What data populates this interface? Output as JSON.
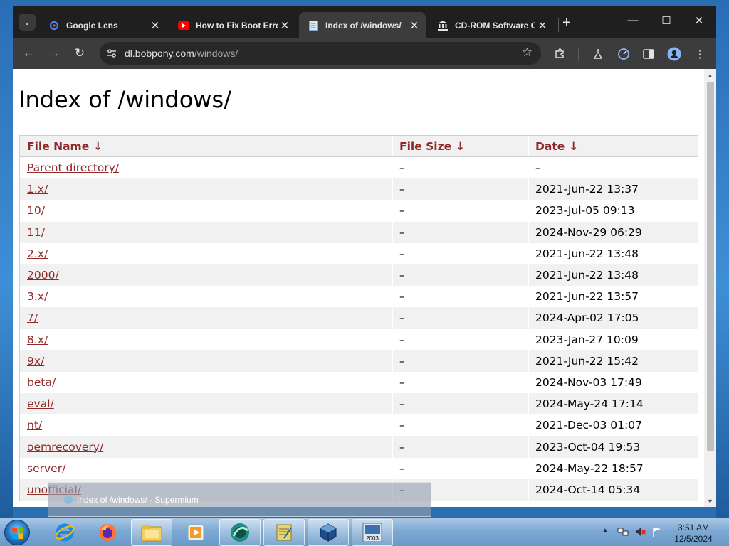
{
  "browser": {
    "name": "Supermium",
    "tabs": [
      {
        "title": "Google Lens",
        "favicon": "google-lens-icon"
      },
      {
        "title": "How to Fix Boot Error",
        "favicon": "youtube-icon"
      },
      {
        "title": "Index of /windows/",
        "favicon": "document-icon",
        "active": true
      },
      {
        "title": "CD-ROM Software Collection",
        "favicon": "bank-icon"
      }
    ],
    "address": {
      "domain": "dl.bobpony.com",
      "path": "/windows/"
    }
  },
  "page": {
    "title": "Index of /windows/",
    "headers": {
      "name": "File Name",
      "size": "File Size",
      "date": "Date",
      "sort_arrow": "↓"
    },
    "rows": [
      {
        "name": "Parent directory/",
        "size": "–",
        "date": "–"
      },
      {
        "name": "1.x/",
        "size": "–",
        "date": "2021-Jun-22 13:37"
      },
      {
        "name": "10/",
        "size": "–",
        "date": "2023-Jul-05 09:13"
      },
      {
        "name": "11/",
        "size": "–",
        "date": "2024-Nov-29 06:29"
      },
      {
        "name": "2.x/",
        "size": "–",
        "date": "2021-Jun-22 13:48"
      },
      {
        "name": "2000/",
        "size": "–",
        "date": "2021-Jun-22 13:48"
      },
      {
        "name": "3.x/",
        "size": "–",
        "date": "2021-Jun-22 13:57"
      },
      {
        "name": "7/",
        "size": "–",
        "date": "2024-Apr-02 17:05"
      },
      {
        "name": "8.x/",
        "size": "–",
        "date": "2023-Jan-27 10:09"
      },
      {
        "name": "9x/",
        "size": "–",
        "date": "2021-Jun-22 15:42"
      },
      {
        "name": "beta/",
        "size": "–",
        "date": "2024-Nov-03 17:49"
      },
      {
        "name": "eval/",
        "size": "–",
        "date": "2024-May-24 17:14"
      },
      {
        "name": "nt/",
        "size": "–",
        "date": "2021-Dec-03 01:07"
      },
      {
        "name": "oemrecovery/",
        "size": "–",
        "date": "2023-Oct-04 19:53"
      },
      {
        "name": "server/",
        "size": "–",
        "date": "2024-May-22 18:57"
      },
      {
        "name": "unofficial/",
        "size": "–",
        "date": "2024-Oct-14 05:34"
      }
    ]
  },
  "taskbar": {
    "preview_title": "Index of /windows/ - Supermium",
    "apps": [
      "internet-explorer-icon",
      "firefox-icon",
      "file-explorer-icon",
      "media-player-icon",
      "supermium-icon",
      "notepad-icon",
      "virtualbox-icon",
      "windows-2003-icon"
    ],
    "badge": "2003",
    "clock_time": "3:51 AM",
    "clock_date": "12/5/2024"
  },
  "colors": {
    "link": "#8e2a2a",
    "tab_bar": "#1f1f1f",
    "toolbar": "#3c3c3c"
  }
}
